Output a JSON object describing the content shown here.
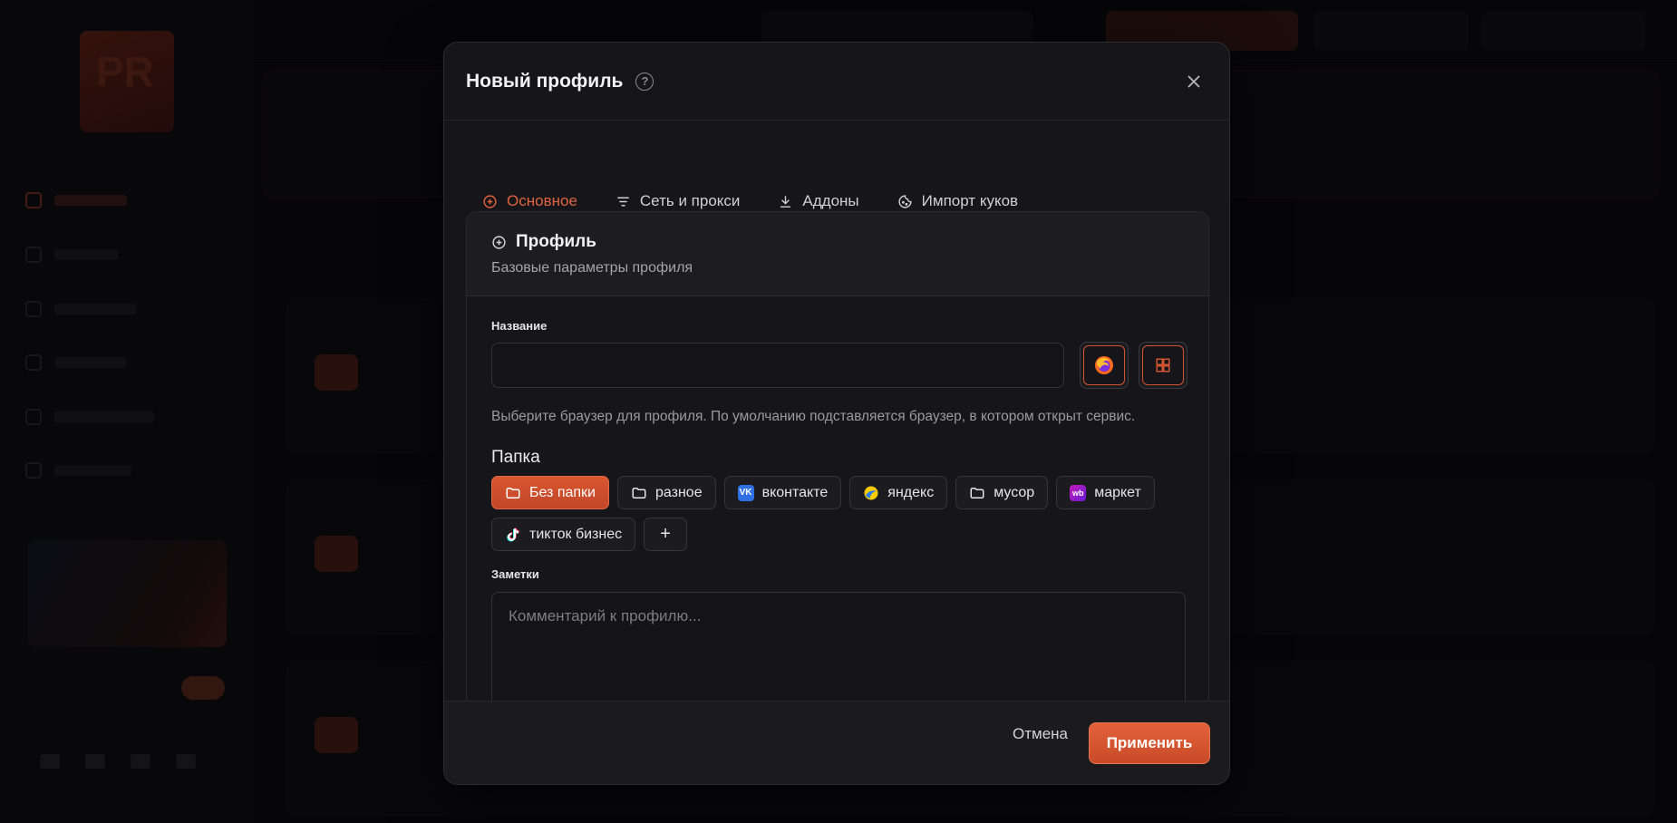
{
  "modal": {
    "title": "Новый профиль",
    "help_icon": "question-circle-icon",
    "close_icon": "close-icon"
  },
  "tabs": [
    {
      "label": "Основное",
      "icon": "plus-circle-icon",
      "active": true
    },
    {
      "label": "Сеть и прокси",
      "icon": "filter-icon",
      "active": false
    },
    {
      "label": "Аддоны",
      "icon": "download-icon",
      "active": false
    },
    {
      "label": "Импорт куков",
      "icon": "cookie-icon",
      "active": false
    }
  ],
  "section": {
    "title": "Профиль",
    "subtitle": "Базовые параметры профиля"
  },
  "name_field": {
    "label": "Название",
    "value": "",
    "placeholder": ""
  },
  "browsers": [
    {
      "name": "firefox-icon"
    },
    {
      "name": "windows-icon"
    }
  ],
  "browser_hint": "Выберите браузер для профиля. По умолчанию подставляется браузер, в котором открыт сервис.",
  "folder_section": {
    "label": "Папка",
    "items": [
      {
        "label": "Без папки",
        "icon": "folder-icon",
        "active": true
      },
      {
        "label": "разное",
        "icon": "folder-icon",
        "active": false
      },
      {
        "label": "вконтакте",
        "icon": "vk-icon",
        "active": false
      },
      {
        "label": "яндекс",
        "icon": "yandex-icon",
        "active": false
      },
      {
        "label": "мусор",
        "icon": "folder-icon",
        "active": false
      },
      {
        "label": "маркет",
        "icon": "wb-icon",
        "active": false
      },
      {
        "label": "тикток бизнес",
        "icon": "tiktok-icon",
        "active": false
      }
    ],
    "add_label": "+"
  },
  "notes": {
    "label": "Заметки",
    "placeholder": "Комментарий к профилю...",
    "value": ""
  },
  "footer": {
    "cancel_label": "Отмена",
    "apply_label": "Применить"
  },
  "colors": {
    "accent": "#e2643f",
    "modal_bg": "#16161a",
    "overlay": "#050507"
  }
}
